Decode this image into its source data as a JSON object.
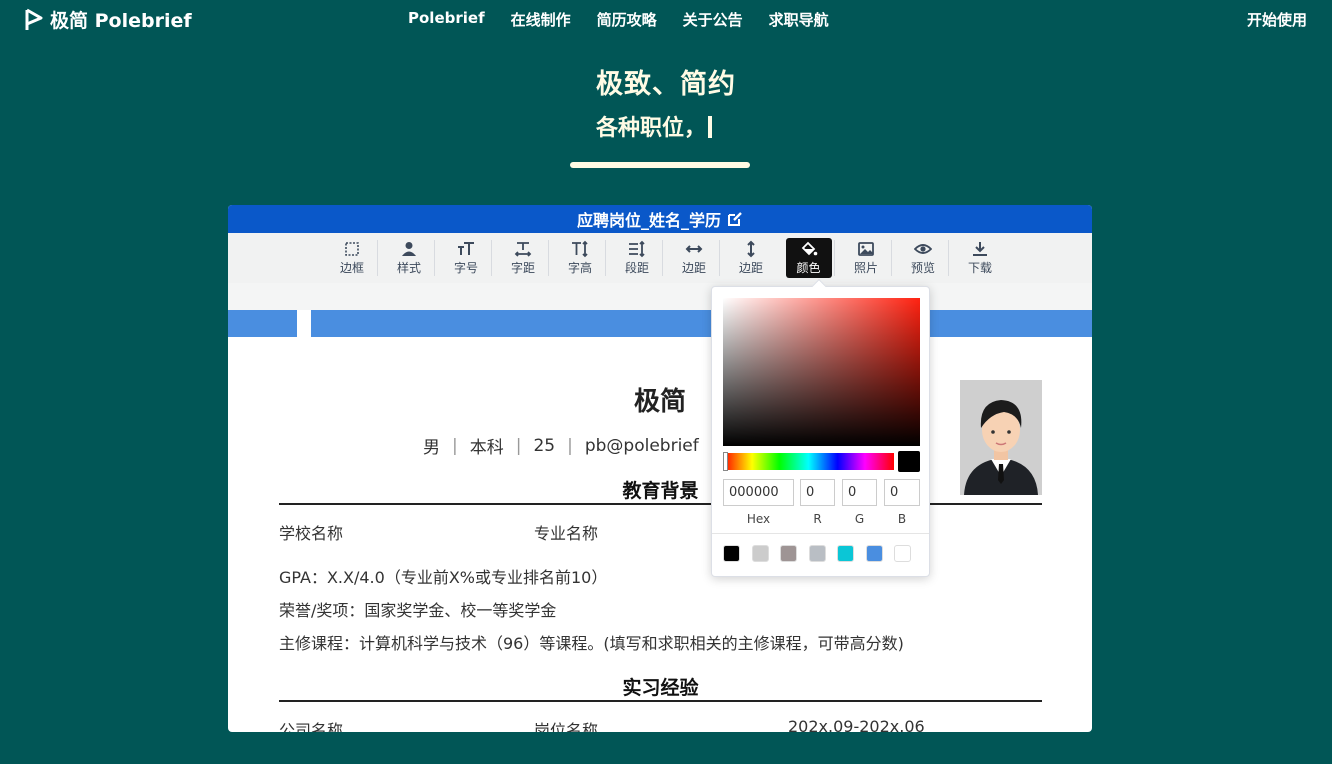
{
  "nav": {
    "brand": "极简 Polebrief",
    "links": [
      "Polebrief",
      "在线制作",
      "简历攻略",
      "关于公告",
      "求职导航"
    ],
    "start": "开始使用"
  },
  "hero": {
    "title": "极致、简约",
    "subtitle": "各种职位，"
  },
  "editor": {
    "title": "应聘岗位_姓名_学历",
    "tools": [
      "边框",
      "样式",
      "字号",
      "字距",
      "字高",
      "段距",
      "边距",
      "边距",
      "颜色",
      "照片",
      "预览",
      "下载"
    ],
    "active_tool": "颜色"
  },
  "resume": {
    "name": "极简",
    "meta": [
      "男",
      "本科",
      "25",
      "pb@polebrief"
    ],
    "education": {
      "heading": "教育背景",
      "school": "学校名称",
      "major": "专业名称",
      "gpa": "GPA：X.X/4.0（专业前X%或专业排名前10）",
      "honors": "荣誉/奖项：国家奖学金、校一等奖学金",
      "courses": "主修课程：计算机科学与技术（96）等课程。(填写和求职相关的主修课程，可带高分数)"
    },
    "internship": {
      "heading": "实习经验",
      "company": "公司名称",
      "position": "岗位名称",
      "period": "202x.09-202x.06"
    }
  },
  "picker": {
    "hex": "000000",
    "r": "0",
    "g": "0",
    "b": "0",
    "labels": {
      "hex": "Hex",
      "r": "R",
      "g": "G",
      "b": "B"
    },
    "presets": [
      "#000000",
      "#cccccc",
      "#9e9494",
      "#b9bec4",
      "#0bc6d6",
      "#4a8ee0",
      "#ffffff"
    ]
  },
  "colors": {
    "background": "#015656",
    "accent_cream": "#fffbe5",
    "title_blue": "#0a58c9",
    "band_blue": "#4a8ee0"
  }
}
